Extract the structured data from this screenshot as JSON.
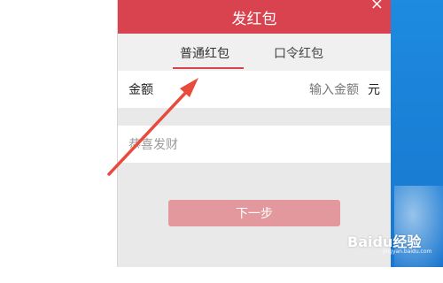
{
  "dialog": {
    "title": "发红包",
    "close_glyph": "×",
    "tabs": [
      {
        "label": "普通红包",
        "active": true
      },
      {
        "label": "口令红包",
        "active": false
      }
    ],
    "amount": {
      "label": "金额",
      "placeholder": "输入金额",
      "unit": "元"
    },
    "blessing": {
      "placeholder": "恭喜发财"
    },
    "next_button": "下一步"
  },
  "colors": {
    "header": "#d9434f",
    "accent": "#d9434f",
    "button_disabled": "#e3989e",
    "annotation_arrow": "#e84a3c"
  },
  "watermark": {
    "brand": "Baidu经验",
    "sub": "jingyan.baidu.com"
  }
}
